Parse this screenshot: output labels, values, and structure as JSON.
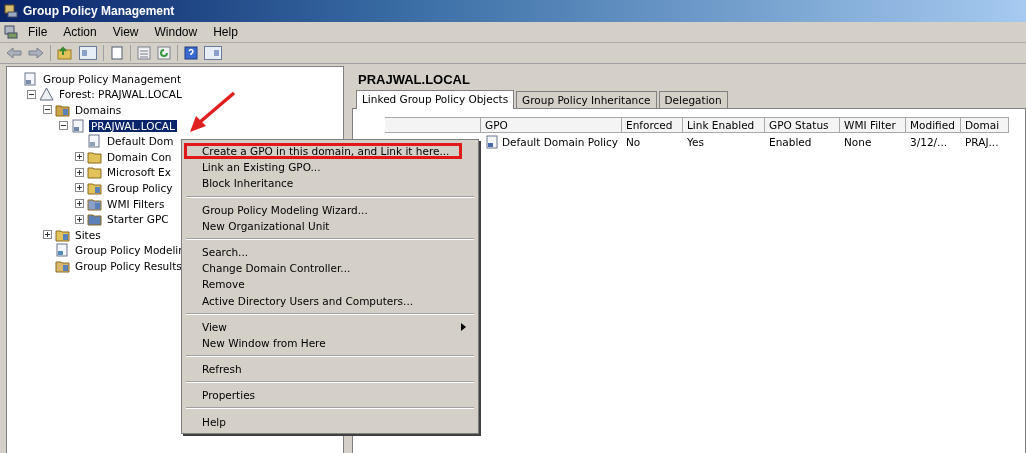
{
  "window": {
    "title": "Group Policy Management"
  },
  "menu_bar": [
    "File",
    "Action",
    "View",
    "Window",
    "Help"
  ],
  "tree": [
    {
      "label": "Group Policy Management",
      "kind": "root",
      "selected": false,
      "children": [
        {
          "label": "Forest: PRAJWAL.LOCAL",
          "kind": "forest",
          "selected": false,
          "expanded": true,
          "children": [
            {
              "label": "Domains",
              "kind": "domains",
              "selected": false,
              "expanded": true,
              "children": [
                {
                  "label": "PRAJWAL.LOCAL",
                  "kind": "domain",
                  "selected": true,
                  "expanded": true,
                  "children": [
                    {
                      "label": "Default Dom",
                      "kind": "gpo",
                      "selected": false
                    },
                    {
                      "label": "Domain Con",
                      "kind": "folder",
                      "selected": false,
                      "expanded": false
                    },
                    {
                      "label": "Microsoft Ex",
                      "kind": "folder",
                      "selected": false,
                      "expanded": false
                    },
                    {
                      "label": "Group Policy",
                      "kind": "gpo-folder",
                      "selected": false,
                      "expanded": false
                    },
                    {
                      "label": "WMI Filters",
                      "kind": "filter",
                      "selected": false,
                      "expanded": false
                    },
                    {
                      "label": "Starter GPC",
                      "kind": "starter",
                      "selected": false,
                      "expanded": false
                    }
                  ]
                }
              ]
            },
            {
              "label": "Sites",
              "kind": "sites",
              "selected": false,
              "expanded": false
            },
            {
              "label": "Group Policy Modelir",
              "kind": "modeling",
              "selected": false
            },
            {
              "label": "Group Policy Results",
              "kind": "results",
              "selected": false
            }
          ]
        }
      ]
    }
  ],
  "details": {
    "title": "PRAJWAL.LOCAL",
    "tabs": [
      {
        "label": "Linked Group Policy Objects",
        "selected": true
      },
      {
        "label": "Group Policy Inheritance",
        "selected": false
      },
      {
        "label": "Delegation",
        "selected": false
      }
    ],
    "table": {
      "columns": [
        "GPO",
        "Enforced",
        "Link Enabled",
        "GPO Status",
        "WMI Filter",
        "Modified",
        "Domai"
      ],
      "rows": [
        [
          "Default Domain Policy",
          "No",
          "Yes",
          "Enabled",
          "None",
          "3/12/...",
          "PRAJ..."
        ]
      ]
    }
  },
  "context_menu": {
    "groups": [
      [
        {
          "label": "Create a GPO in this domain, and Link it here...",
          "highlighted": true
        },
        {
          "label": "Link an Existing GPO...",
          "highlighted": false
        },
        {
          "label": "Block Inheritance",
          "highlighted": false
        }
      ],
      [
        {
          "label": "Group Policy Modeling Wizard...",
          "highlighted": false
        },
        {
          "label": "New Organizational Unit",
          "highlighted": false
        }
      ],
      [
        {
          "label": "Search...",
          "highlighted": false
        },
        {
          "label": "Change Domain Controller...",
          "highlighted": false
        },
        {
          "label": "Remove",
          "highlighted": false
        },
        {
          "label": "Active Directory Users and Computers...",
          "highlighted": false
        }
      ],
      [
        {
          "label": "View",
          "highlighted": false,
          "submenu": true
        },
        {
          "label": "New Window from Here",
          "highlighted": false
        }
      ],
      [
        {
          "label": "Refresh",
          "highlighted": false
        }
      ],
      [
        {
          "label": "Properties",
          "highlighted": false
        }
      ],
      [
        {
          "label": "Help",
          "highlighted": false
        }
      ]
    ]
  }
}
